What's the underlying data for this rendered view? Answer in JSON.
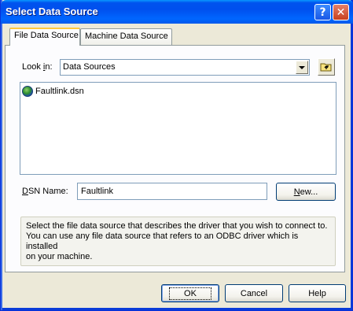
{
  "window": {
    "title": "Select Data Source"
  },
  "tabs": [
    {
      "label": "File Data Source",
      "active": true
    },
    {
      "label": "Machine Data Source",
      "active": false
    }
  ],
  "look_in": {
    "label_pre": "Look ",
    "label_accel": "i",
    "label_post": "n:",
    "value": "Data Sources"
  },
  "file_list": [
    {
      "name": "Faultlink.dsn",
      "icon": "globe-icon"
    }
  ],
  "dsn": {
    "label_accel": "D",
    "label_post": "SN Name:",
    "value": "Faultlink"
  },
  "new_button": {
    "accel": "N",
    "rest": "ew..."
  },
  "info_lines": [
    "Select the file data source that describes the driver that you wish to connect to.",
    "You can use any file data source that refers to an ODBC driver which is installed",
    "on your machine."
  ],
  "buttons": {
    "ok": "OK",
    "cancel": "Cancel",
    "help": "Help"
  },
  "titlebar_icons": {
    "help": "?",
    "close": "✕"
  }
}
